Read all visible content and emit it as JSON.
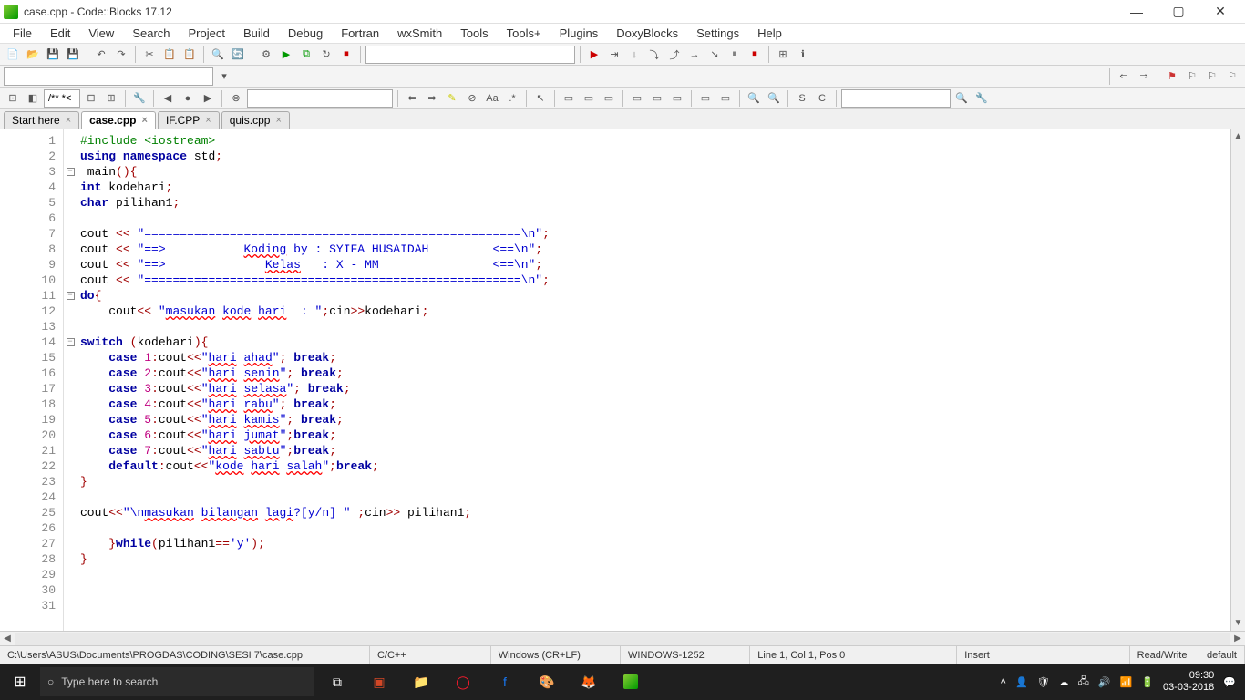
{
  "window": {
    "title": "case.cpp - Code::Blocks 17.12"
  },
  "menu": [
    "File",
    "Edit",
    "View",
    "Search",
    "Project",
    "Build",
    "Debug",
    "Fortran",
    "wxSmith",
    "Tools",
    "Tools+",
    "Plugins",
    "DoxyBlocks",
    "Settings",
    "Help"
  ],
  "tabs": [
    {
      "label": "Start here",
      "active": false
    },
    {
      "label": "case.cpp",
      "active": true
    },
    {
      "label": "IF.CPP",
      "active": false
    },
    {
      "label": "quis.cpp",
      "active": false
    }
  ],
  "code": {
    "lines": [
      {
        "n": 1,
        "fold": "",
        "html": "<span class='pp'>#include &lt;iostream&gt;</span>"
      },
      {
        "n": 2,
        "fold": "",
        "html": "<span class='kw'>using</span> <span class='kw'>namespace</span> std<span class='op'>;</span>"
      },
      {
        "n": 3,
        "fold": "-",
        "html": " main<span class='op'>(){</span>"
      },
      {
        "n": 4,
        "fold": "",
        "html": "<span class='kw'>int</span> kodehari<span class='op'>;</span>"
      },
      {
        "n": 5,
        "fold": "",
        "html": "<span class='kw'>char</span> pilihan1<span class='op'>;</span>"
      },
      {
        "n": 6,
        "fold": "",
        "html": ""
      },
      {
        "n": 7,
        "fold": "",
        "html": "cout <span class='op'>&lt;&lt;</span> <span class='str'>\"=====================================================\\n\"</span><span class='op'>;</span>"
      },
      {
        "n": 8,
        "fold": "",
        "html": "cout <span class='op'>&lt;&lt;</span> <span class='str'>\"==&gt;           <span class='underline'>Koding</span> by : SYIFA HUSAIDAH         &lt;==\\n\"</span><span class='op'>;</span>"
      },
      {
        "n": 9,
        "fold": "",
        "html": "cout <span class='op'>&lt;&lt;</span> <span class='str'>\"==&gt;              <span class='underline'>Kelas</span>   : X - MM                &lt;==\\n\"</span><span class='op'>;</span>"
      },
      {
        "n": 10,
        "fold": "",
        "html": "cout <span class='op'>&lt;&lt;</span> <span class='str'>\"=====================================================\\n\"</span><span class='op'>;</span>"
      },
      {
        "n": 11,
        "fold": "-",
        "html": "<span class='kw'>do</span><span class='op'>{</span>"
      },
      {
        "n": 12,
        "fold": "",
        "html": "    cout<span class='op'>&lt;&lt;</span> <span class='str'>\"<span class='underline'>masukan</span> <span class='underline'>kode</span> <span class='underline'>hari</span>  : \"</span><span class='op'>;</span>cin<span class='op'>&gt;&gt;</span>kodehari<span class='op'>;</span>"
      },
      {
        "n": 13,
        "fold": "",
        "html": ""
      },
      {
        "n": 14,
        "fold": "-",
        "html": "<span class='kw'>switch</span> <span class='op'>(</span>kodehari<span class='op'>){</span>"
      },
      {
        "n": 15,
        "fold": "",
        "html": "    <span class='kw'>case</span> <span class='num'>1</span><span class='op'>:</span>cout<span class='op'>&lt;&lt;</span><span class='str'>\"<span class='underline'>hari</span> <span class='underline'>ahad</span>\"</span><span class='op'>;</span> <span class='kw'>break</span><span class='op'>;</span>"
      },
      {
        "n": 16,
        "fold": "",
        "html": "    <span class='kw'>case</span> <span class='num'>2</span><span class='op'>:</span>cout<span class='op'>&lt;&lt;</span><span class='str'>\"<span class='underline'>hari</span> <span class='underline'>senin</span>\"</span><span class='op'>;</span> <span class='kw'>break</span><span class='op'>;</span>"
      },
      {
        "n": 17,
        "fold": "",
        "html": "    <span class='kw'>case</span> <span class='num'>3</span><span class='op'>:</span>cout<span class='op'>&lt;&lt;</span><span class='str'>\"<span class='underline'>hari</span> <span class='underline'>selasa</span>\"</span><span class='op'>;</span> <span class='kw'>break</span><span class='op'>;</span>"
      },
      {
        "n": 18,
        "fold": "",
        "html": "    <span class='kw'>case</span> <span class='num'>4</span><span class='op'>:</span>cout<span class='op'>&lt;&lt;</span><span class='str'>\"<span class='underline'>hari</span> <span class='underline'>rabu</span>\"</span><span class='op'>;</span> <span class='kw'>break</span><span class='op'>;</span>"
      },
      {
        "n": 19,
        "fold": "",
        "html": "    <span class='kw'>case</span> <span class='num'>5</span><span class='op'>:</span>cout<span class='op'>&lt;&lt;</span><span class='str'>\"<span class='underline'>hari</span> <span class='underline'>kamis</span>\"</span><span class='op'>;</span> <span class='kw'>break</span><span class='op'>;</span>"
      },
      {
        "n": 20,
        "fold": "",
        "html": "    <span class='kw'>case</span> <span class='num'>6</span><span class='op'>:</span>cout<span class='op'>&lt;&lt;</span><span class='str'>\"<span class='underline'>hari</span> <span class='underline'>jumat</span>\"</span><span class='op'>;</span><span class='kw'>break</span><span class='op'>;</span>"
      },
      {
        "n": 21,
        "fold": "",
        "html": "    <span class='kw'>case</span> <span class='num'>7</span><span class='op'>:</span>cout<span class='op'>&lt;&lt;</span><span class='str'>\"<span class='underline'>hari</span> <span class='underline'>sabtu</span>\"</span><span class='op'>;</span><span class='kw'>break</span><span class='op'>;</span>"
      },
      {
        "n": 22,
        "fold": "",
        "html": "    <span class='kw'>default</span><span class='op'>:</span>cout<span class='op'>&lt;&lt;</span><span class='str'>\"<span class='underline'>kode</span> <span class='underline'>hari</span> <span class='underline'>salah</span>\"</span><span class='op'>;</span><span class='kw'>break</span><span class='op'>;</span>"
      },
      {
        "n": 23,
        "fold": "",
        "html": "<span class='op'>}</span>"
      },
      {
        "n": 24,
        "fold": "",
        "html": ""
      },
      {
        "n": 25,
        "fold": "",
        "html": "cout<span class='op'>&lt;&lt;</span><span class='str'>\"\\n<span class='underline'>masukan</span> <span class='underline'>bilangan</span> <span class='underline'>lagi</span>?[y/n] \"</span> <span class='op'>;</span>cin<span class='op'>&gt;&gt;</span> pilihan1<span class='op'>;</span>"
      },
      {
        "n": 26,
        "fold": "",
        "html": ""
      },
      {
        "n": 27,
        "fold": "",
        "html": "    <span class='op'>}</span><span class='kw'>while</span><span class='op'>(</span>pilihan1<span class='op'>==</span><span class='str'>'y'</span><span class='op'>);</span>"
      },
      {
        "n": 28,
        "fold": "",
        "html": "<span class='op'>}</span>"
      },
      {
        "n": 29,
        "fold": "",
        "html": ""
      },
      {
        "n": 30,
        "fold": "",
        "html": ""
      },
      {
        "n": 31,
        "fold": "",
        "html": ""
      }
    ]
  },
  "toolbar2": {
    "comment": "/** *<"
  },
  "status": {
    "path": "C:\\Users\\ASUS\\Documents\\PROGDAS\\CODING\\SESI 7\\case.cpp",
    "lang": "C/C++",
    "eol": "Windows (CR+LF)",
    "encoding": "WINDOWS-1252",
    "position": "Line 1, Col 1, Pos 0",
    "insert": "Insert",
    "rw": "Read/Write",
    "profile": "default"
  },
  "taskbar": {
    "search_placeholder": "Type here to search",
    "time": "09:30",
    "date": "03-03-2018"
  }
}
